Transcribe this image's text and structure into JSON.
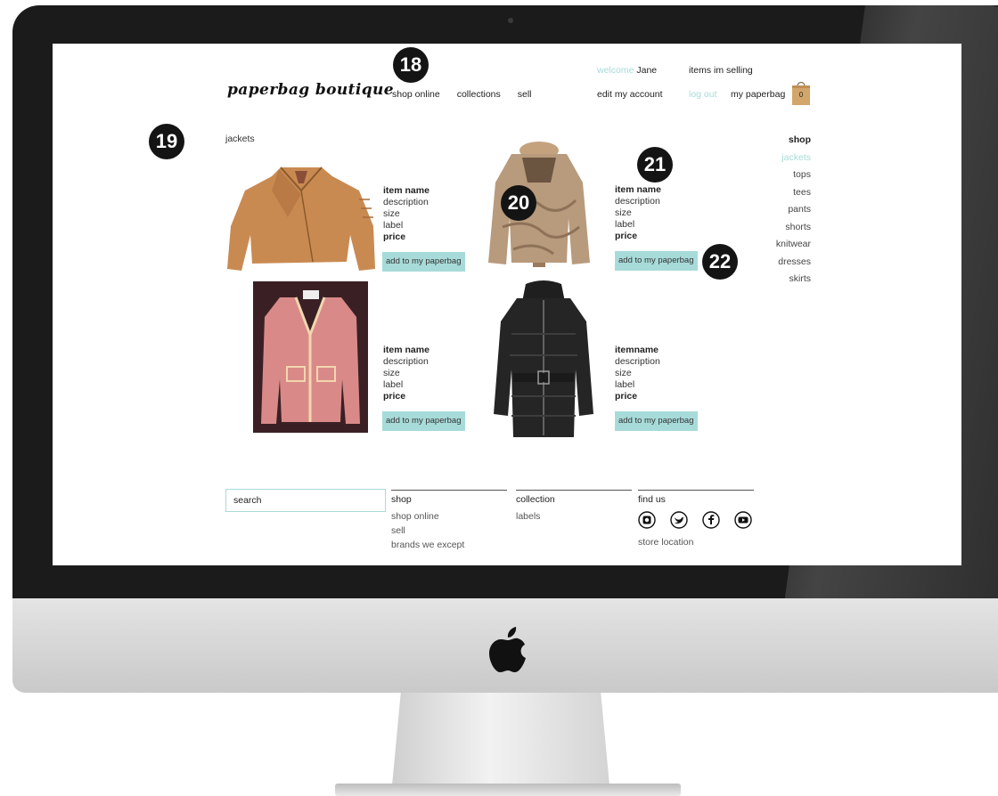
{
  "header": {
    "logo": "paperbag boutique",
    "nav": [
      "shop online",
      "collections",
      "sell"
    ],
    "account": {
      "welcome_label": "welcome",
      "user_name": "Jane",
      "items_selling": "items im selling",
      "edit_account": "edit my account",
      "log_out": "log out",
      "bag_label": "my paperbag",
      "bag_count": "0"
    }
  },
  "page": {
    "title": "jackets"
  },
  "sidebar": {
    "heading": "shop",
    "items": [
      "jackets",
      "tops",
      "tees",
      "pants",
      "shorts",
      "knitwear",
      "dresses",
      "skirts"
    ],
    "active": "jackets"
  },
  "products": [
    {
      "name": "item name",
      "description": "description",
      "size": "size",
      "label": "label",
      "price": "price",
      "button": "add to my paperbag",
      "image": "tan-leather-biker-jacket"
    },
    {
      "name": "item name",
      "description": "description",
      "size": "size",
      "label": "label",
      "price": "price",
      "button": "add to my paperbag",
      "image": "fur-jacket"
    },
    {
      "name": "item name",
      "description": "description",
      "size": "size",
      "label": "label",
      "price": "price",
      "button": "add to my paperbag",
      "image": "pink-tweed-jacket"
    },
    {
      "name": "itemname",
      "description": "description",
      "size": "size",
      "label": "label",
      "price": "price",
      "button": "add to my paperbag",
      "image": "black-puffer-jacket"
    }
  ],
  "footer": {
    "search_value": "search",
    "shop": {
      "heading": "shop",
      "links": [
        "shop online",
        "sell",
        "brands we except"
      ]
    },
    "collection": {
      "heading": "collection",
      "links": [
        "labels"
      ]
    },
    "find_us": {
      "heading": "find us",
      "social": [
        "instagram-icon",
        "twitter-icon",
        "facebook-icon",
        "youtube-icon"
      ],
      "store_location": "store location"
    }
  },
  "annotations": [
    "18",
    "19",
    "20",
    "21",
    "22"
  ],
  "colors": {
    "accent": "#a7dbd9",
    "bezel": "#1b1b1b",
    "badge": "#141414"
  }
}
